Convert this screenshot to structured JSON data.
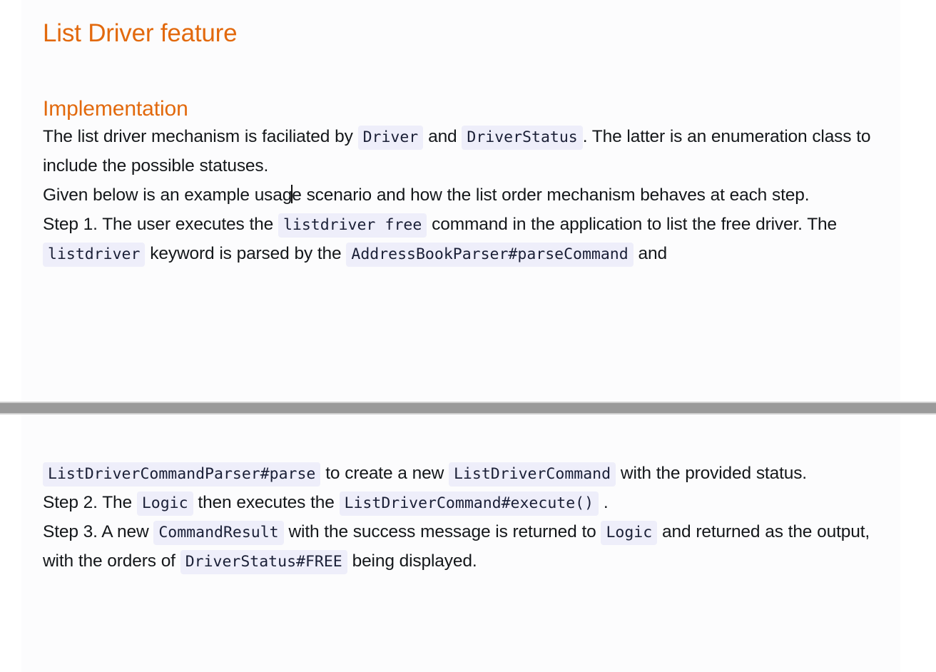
{
  "document": {
    "title": "List Driver feature",
    "section_heading": "Implementation"
  },
  "paragraphs": {
    "intro": {
      "part1": "The list driver mechanism is faciliated by ",
      "code1": "Driver",
      "part2": " and ",
      "code2": "DriverStatus",
      "part3": ". The latter is an enumeration class to include the possible statuses."
    },
    "usage": {
      "part1": "Given below is an example usag",
      "caret": "|",
      "part2": "e scenario and how the list order mechanism behaves at each step."
    },
    "step1": {
      "part1": "Step 1. The user executes the ",
      "code1": "listdriver free",
      "part2": " command in the application to list the free driver. The ",
      "code2": "listdriver",
      "part3": " keyword is parsed by the ",
      "code3": "AddressBookParser#parseCommand",
      "part4": " and"
    },
    "step1_cont": {
      "code1": "ListDriverCommandParser#parse",
      "part1": " to create a new ",
      "code2": "ListDriverCommand",
      "part2": " with the provided status."
    },
    "step2": {
      "part1": "Step 2. The ",
      "code1": "Logic",
      "part2": " then executes the ",
      "code2": "ListDriverCommand#execute()",
      "part3": " ."
    },
    "step3": {
      "part1": "Step 3. A new ",
      "code1": "CommandResult",
      "part2": " with the success message is returned to ",
      "code2": "Logic",
      "part3": " and returned as the output, with the orders of ",
      "code3": "DriverStatus#FREE",
      "part4": " being displayed."
    }
  },
  "colors": {
    "heading": "#e2690d",
    "body_text": "#14171a",
    "code_background": "#eeeefa",
    "code_text": "#1a1f36",
    "page_background": "#fcfcfd",
    "separator": "#9a9a9a"
  }
}
